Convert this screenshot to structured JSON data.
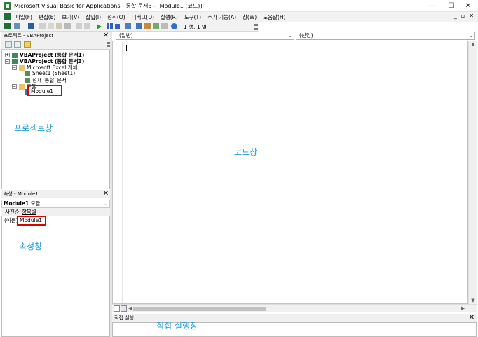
{
  "titlebar": {
    "title": "Microsoft Visual Basic for Applications - 통합 문서3 - [Module1 (코드)]",
    "minimize": "—",
    "maximize": "☐",
    "close": "✕"
  },
  "menubar": {
    "items": [
      "파일(F)",
      "편집(E)",
      "보기(V)",
      "삽입(I)",
      "형식(O)",
      "디버그(D)",
      "실행(R)",
      "도구(T)",
      "추가 기능(A)",
      "창(W)",
      "도움말(H)"
    ],
    "right_controls": [
      "_",
      "▫",
      "✕"
    ]
  },
  "toolbar": {
    "position_text": "1 행, 1 열"
  },
  "project_pane": {
    "title": "프로젝트 - VBAProject",
    "close": "✕",
    "tree": [
      {
        "label": "VBAProject (통합 문서1)",
        "bold": true
      },
      {
        "label": "VBAProject (통합 문서3)",
        "bold": true
      },
      {
        "label": "Microsoft Excel 개체",
        "bold": false
      },
      {
        "label": "Sheet1 (Sheet1)",
        "bold": false
      },
      {
        "label": "현재_통합_문서",
        "bold": false
      },
      {
        "label": "모듈",
        "bold": false
      },
      {
        "label": "Module1",
        "bold": false
      }
    ],
    "annotation": "프로젝트창"
  },
  "properties_pane": {
    "title": "속성 - Module1",
    "close": "✕",
    "object_name": "Module1",
    "object_type": "모듈",
    "tabs": [
      "사전순",
      "항목별"
    ],
    "property_name": "(이름)",
    "property_value": "Module1",
    "annotation": "속성창"
  },
  "code_window": {
    "object_combo": "(일반)",
    "proc_combo": "(선언)",
    "annotation": "코드창"
  },
  "immediate_pane": {
    "title": "직접 실행",
    "close": "✕",
    "annotation": "직접 실행창"
  },
  "colors": {
    "annotation": "#1e9ad6",
    "highlight_box": "#e00000"
  }
}
